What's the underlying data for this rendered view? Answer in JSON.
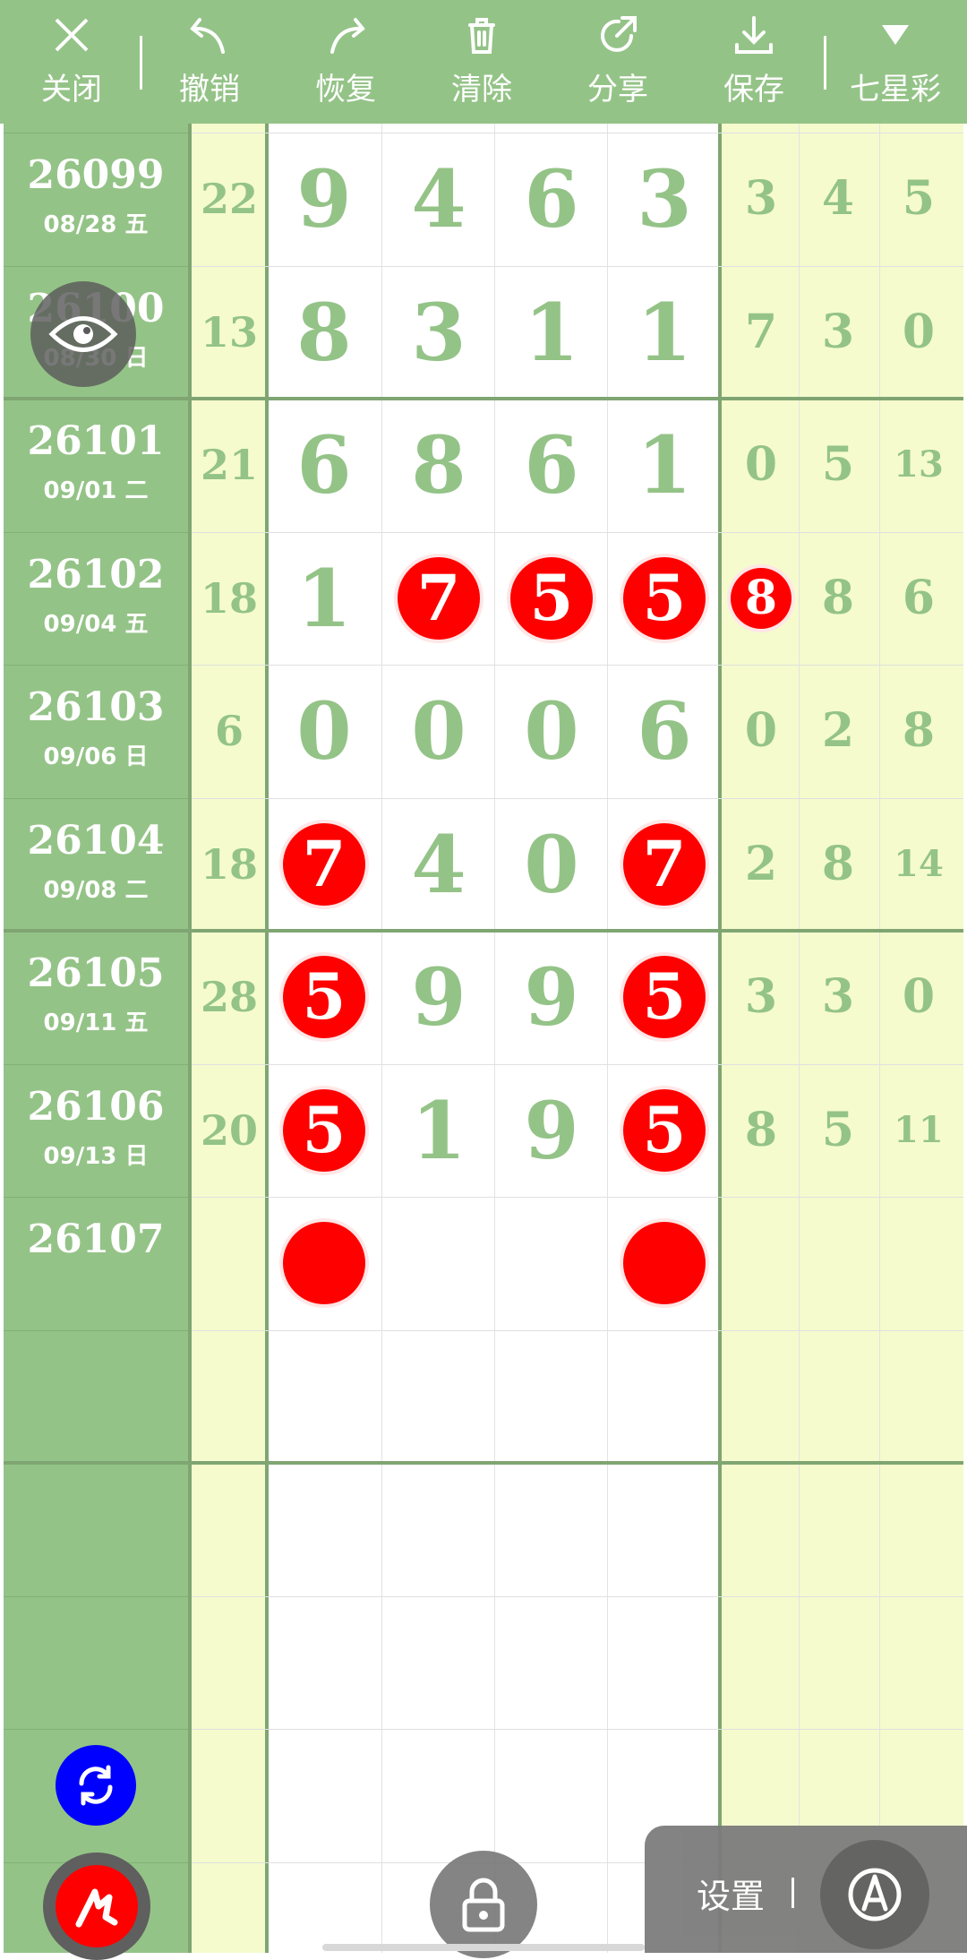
{
  "toolbar": {
    "close": "关闭",
    "undo": "撤销",
    "redo": "恢复",
    "clear": "清除",
    "share": "分享",
    "save": "保存",
    "lottery": "七星彩"
  },
  "rows": [
    {
      "period": "26099",
      "date": "08/28 五",
      "sum": "22",
      "main": [
        "9",
        "4",
        "6",
        "3"
      ],
      "right": [
        "3",
        "4",
        "5"
      ]
    },
    {
      "period": "26100",
      "date": "08/30 日",
      "sum": "13",
      "main": [
        "8",
        "3",
        "1",
        "1"
      ],
      "right": [
        "7",
        "3",
        "0"
      ]
    },
    {
      "period": "26101",
      "date": "09/01 二",
      "sum": "21",
      "main": [
        "6",
        "8",
        "6",
        "1"
      ],
      "right": [
        "0",
        "5",
        "13"
      ]
    },
    {
      "period": "26102",
      "date": "09/04 五",
      "sum": "18",
      "main": [
        "1",
        "7",
        "5",
        "5"
      ],
      "right": [
        "8",
        "8",
        "6"
      ]
    },
    {
      "period": "26103",
      "date": "09/06 日",
      "sum": "6",
      "main": [
        "0",
        "0",
        "0",
        "6"
      ],
      "right": [
        "0",
        "2",
        "8"
      ]
    },
    {
      "period": "26104",
      "date": "09/08 二",
      "sum": "18",
      "main": [
        "7",
        "4",
        "0",
        "7"
      ],
      "right": [
        "2",
        "8",
        "14"
      ]
    },
    {
      "period": "26105",
      "date": "09/11 五",
      "sum": "28",
      "main": [
        "5",
        "9",
        "9",
        "5"
      ],
      "right": [
        "3",
        "3",
        "0"
      ]
    },
    {
      "period": "26106",
      "date": "09/13 日",
      "sum": "20",
      "main": [
        "5",
        "1",
        "9",
        "5"
      ],
      "right": [
        "8",
        "5",
        "11"
      ]
    },
    {
      "period": "26107",
      "date": "",
      "sum": "",
      "main": [
        "",
        "",
        "",
        ""
      ],
      "right": [
        "",
        "",
        ""
      ]
    }
  ],
  "highlights": [
    {
      "row": 3,
      "col": "main",
      "index": 1
    },
    {
      "row": 3,
      "col": "main",
      "index": 2
    },
    {
      "row": 3,
      "col": "main",
      "index": 3
    },
    {
      "row": 3,
      "col": "right",
      "index": 0
    },
    {
      "row": 5,
      "col": "main",
      "index": 0
    },
    {
      "row": 5,
      "col": "main",
      "index": 3
    },
    {
      "row": 6,
      "col": "main",
      "index": 0
    },
    {
      "row": 6,
      "col": "main",
      "index": 3
    },
    {
      "row": 7,
      "col": "main",
      "index": 0
    },
    {
      "row": 7,
      "col": "main",
      "index": 3
    },
    {
      "row": 8,
      "col": "main",
      "index": 0
    },
    {
      "row": 8,
      "col": "main",
      "index": 3
    }
  ],
  "settings": {
    "label": "设置"
  },
  "icons": {
    "close": "close-icon",
    "undo": "undo-icon",
    "redo": "redo-icon",
    "clear": "trash-icon",
    "share": "share-icon",
    "save": "download-icon",
    "lottery": "dropdown-triangle-icon",
    "eye": "eye-icon",
    "refresh": "refresh-icon",
    "pen": "pen-icon",
    "lock": "lock-icon",
    "compass": "compass-icon"
  },
  "colors": {
    "toolbar": "#94c387",
    "period_column": "#94c387",
    "light_column": "#f5fbcd",
    "digit": "#94c387",
    "ball": "#ff0000",
    "refresh_button": "#0000ff"
  }
}
